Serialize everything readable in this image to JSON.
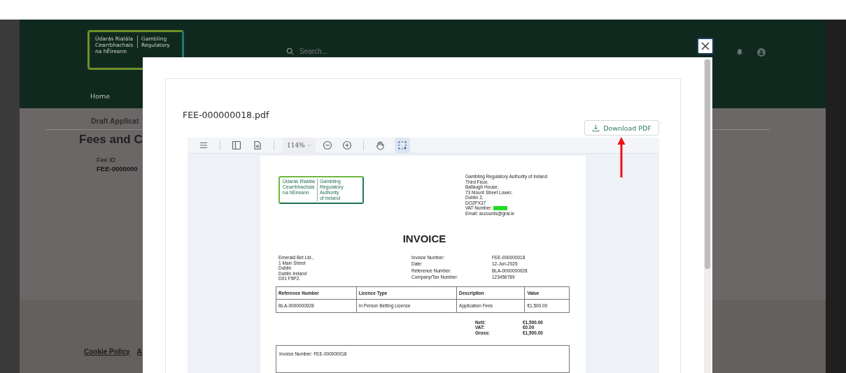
{
  "header": {
    "logo_irish": [
      "Údarás Rialála",
      "Cearrbhachais",
      "na hÉireann"
    ],
    "logo_english": [
      "Gambling",
      "Regulatory"
    ],
    "search": {
      "placeholder": "Search..."
    }
  },
  "nav": [
    {
      "label": "Home",
      "selected": false
    }
  ],
  "breadcrumb": "Draft Applicat",
  "page_title": "Fees and C",
  "fee": {
    "label": "Fee ID",
    "value": "FEE-0000000"
  },
  "footer_links": [
    "Cookie Policy",
    "A"
  ],
  "modal": {
    "title": "FEE-000000018.pdf",
    "download_button": "Download PDF",
    "toolbar": {
      "zoom": "114%",
      "tools": [
        {
          "kind": "hand",
          "selected": false
        },
        {
          "kind": "select",
          "selected": true
        }
      ]
    },
    "invoice": {
      "logo_irish": [
        "Údarás Rialála",
        "Cearrbhachais",
        "na hÉireann"
      ],
      "logo_english": [
        "Gambling",
        "Regulatory",
        "Authority",
        "of Ireland"
      ],
      "address": [
        "Gambling Regulatory Authority of Ireland",
        "Third Floor,",
        "Ballaugh House,",
        "73 Mount Street Lower,",
        "Dublin 2,",
        "DO2PX37"
      ],
      "vat": {
        "label": "VAT Number:",
        "redacted": true
      },
      "email": "Email: accounts@grai.ie",
      "title": "INVOICE",
      "bill_to": [
        "Emerald Bet Ltd.,",
        "1 Main Street",
        "Dublin",
        "Dublin Ireland",
        "D01 F5P2."
      ],
      "details": [
        {
          "label": "Invoice Number:",
          "value": "FEE-000000018"
        },
        {
          "label": "Date:",
          "value": "12-Jun-2025"
        },
        {
          "label": "Reference Number:",
          "value": "BLA-0000000028"
        },
        {
          "label": "Company/Tax Number:",
          "value": "123456789"
        }
      ],
      "table": {
        "columns": [
          "Reference Number",
          "Licence Type",
          "Description",
          "Value"
        ],
        "rows": [
          [
            "BLA-0000000028",
            "In Person Betting Licence",
            "Application Fees",
            "€1,500.00"
          ]
        ]
      },
      "totals": [
        {
          "label": "Nett:",
          "value": "€1,500.00"
        },
        {
          "label": "VAT:",
          "value": "€0.00"
        },
        {
          "label": "Gross:",
          "value": "€1,500.00"
        }
      ],
      "note": "Invoice Number: FEE-000000018"
    }
  }
}
